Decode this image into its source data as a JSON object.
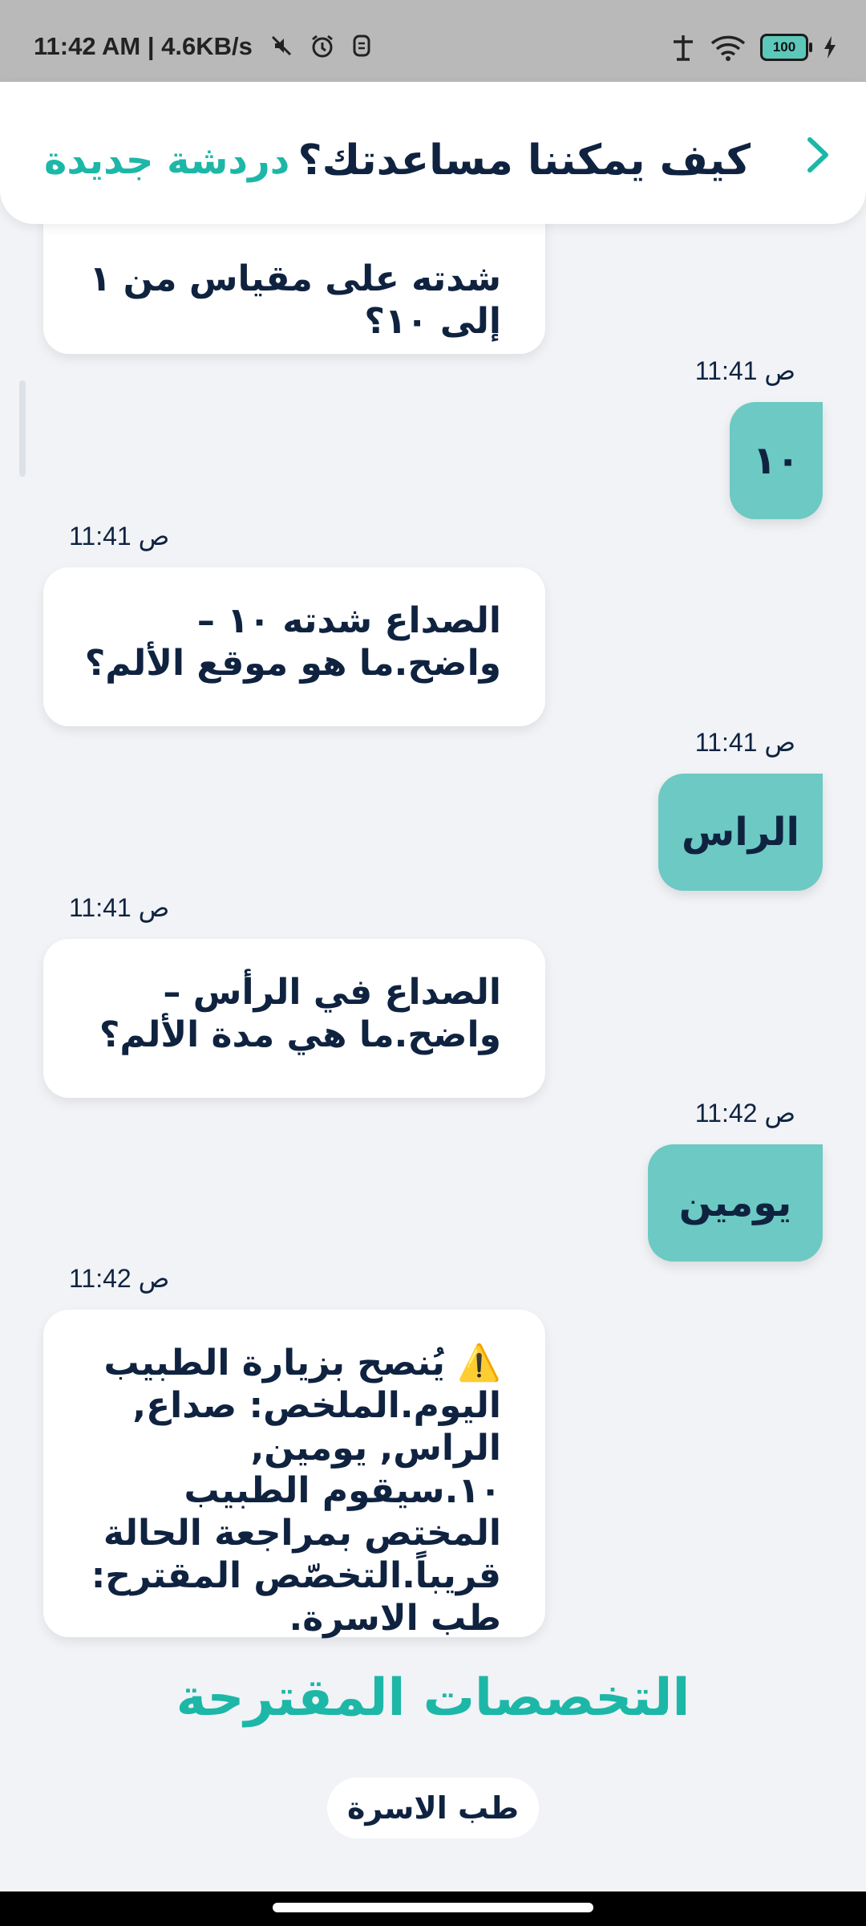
{
  "status_bar": {
    "time": "11:42 AM | 4.6KB/s",
    "battery": "100"
  },
  "header": {
    "title": "كيف يمكننا مساعدتك؟",
    "new_chat": "دردشة جديدة"
  },
  "messages": [
    {
      "sender": "bot",
      "text": "شدته على مقياس من ١ إلى ١٠؟",
      "partial_top": "...",
      "time": ""
    },
    {
      "sender": "user",
      "text": "١٠",
      "time": "11:41 ص"
    },
    {
      "sender": "bot",
      "text": "الصداع شدته ١٠ – واضح.ما هو موقع الألم؟",
      "time": "11:41 ص"
    },
    {
      "sender": "user",
      "text": "الراس",
      "time": "11:41 ص"
    },
    {
      "sender": "bot",
      "text": "الصداع في الرأس – واضح.ما هي مدة الألم؟",
      "time": "11:41 ص"
    },
    {
      "sender": "user",
      "text": "يومين",
      "time": "11:42 ص"
    },
    {
      "sender": "bot",
      "text": "⚠️ يُنصح بزيارة الطبيب اليوم.الملخص: صداع, الراس, يومين, ١٠.سيقوم الطبيب المختص بمراجعة الحالة قريباً.التخصّص المقترح: طب الاسرة.",
      "time": "11:42 ص"
    }
  ],
  "suggested": {
    "title": "التخصصات المقترحة",
    "items": [
      "طب الاسرة"
    ]
  }
}
